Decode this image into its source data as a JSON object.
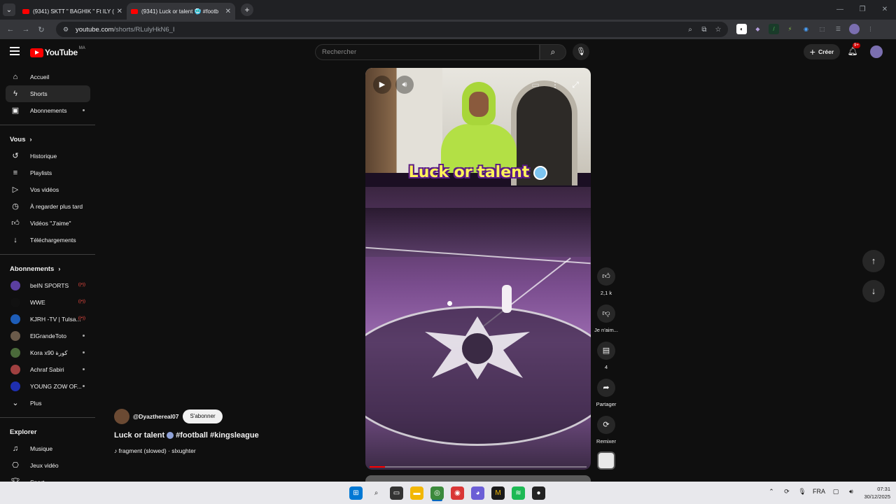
{
  "browser": {
    "tabs": [
      {
        "title": "(9341) SKTT \" BAGHIK \" Ft ILY (O"
      },
      {
        "title": "(9341) Luck or talent 🥶 #footb"
      }
    ],
    "url_host": "youtube.com",
    "url_path": "/shorts/RLulyHkN6_I"
  },
  "header": {
    "logo_text": "YouTube",
    "country_code": "MA",
    "search_placeholder": "Rechercher",
    "create_label": "Créer",
    "notification_count": "9+"
  },
  "sidebar": {
    "main": [
      {
        "label": "Accueil",
        "icon": "home-icon"
      },
      {
        "label": "Shorts",
        "icon": "shorts-icon"
      },
      {
        "label": "Abonnements",
        "icon": "subscriptions-icon"
      }
    ],
    "you_heading": "Vous",
    "you": [
      {
        "label": "Historique",
        "icon": "history-icon"
      },
      {
        "label": "Playlists",
        "icon": "playlists-icon"
      },
      {
        "label": "Vos vidéos",
        "icon": "your-videos-icon"
      },
      {
        "label": "À regarder plus tard",
        "icon": "watch-later-icon"
      },
      {
        "label": "Vidéos \"J'aime\"",
        "icon": "liked-icon"
      },
      {
        "label": "Téléchargements",
        "icon": "downloads-icon"
      }
    ],
    "subs_heading": "Abonnements",
    "subs": [
      {
        "label": "beIN SPORTS",
        "color": "#5b3fa0"
      },
      {
        "label": "WWE",
        "color": "#111111"
      },
      {
        "label": "KJRH -TV | Tulsa...",
        "color": "#1e5db8"
      },
      {
        "label": "ElGrandeToto",
        "color": "#6a5a4a"
      },
      {
        "label": "Kora x90 كورة",
        "color": "#4a6a3a"
      },
      {
        "label": "Achraf Sabiri",
        "color": "#a04040"
      },
      {
        "label": "YOUNG ZOW OF...",
        "color": "#1f2fb0"
      }
    ],
    "more_label": "Plus",
    "explore_heading": "Explorer",
    "explore": [
      {
        "label": "Musique",
        "icon": "music-icon"
      },
      {
        "label": "Jeux vidéo",
        "icon": "gaming-icon"
      },
      {
        "label": "Sport",
        "icon": "trophy-icon"
      }
    ]
  },
  "video": {
    "caption": "Luck or talent",
    "progress": 0.07
  },
  "actions": {
    "likes": "2,1 k",
    "dislike_label": "Je n'aim...",
    "comments": "4",
    "share_label": "Partager",
    "remix_label": "Remixer"
  },
  "meta": {
    "channel": "@Dyazthereal07",
    "subscribe_label": "S'abonner",
    "title_pre": "Luck or talent",
    "title_post": "#football #kingsleague",
    "music": "fragment (slowed) · slxughter"
  },
  "taskbar": {
    "lang": "FRA",
    "time": "07:31",
    "date": "30/12/2025"
  }
}
